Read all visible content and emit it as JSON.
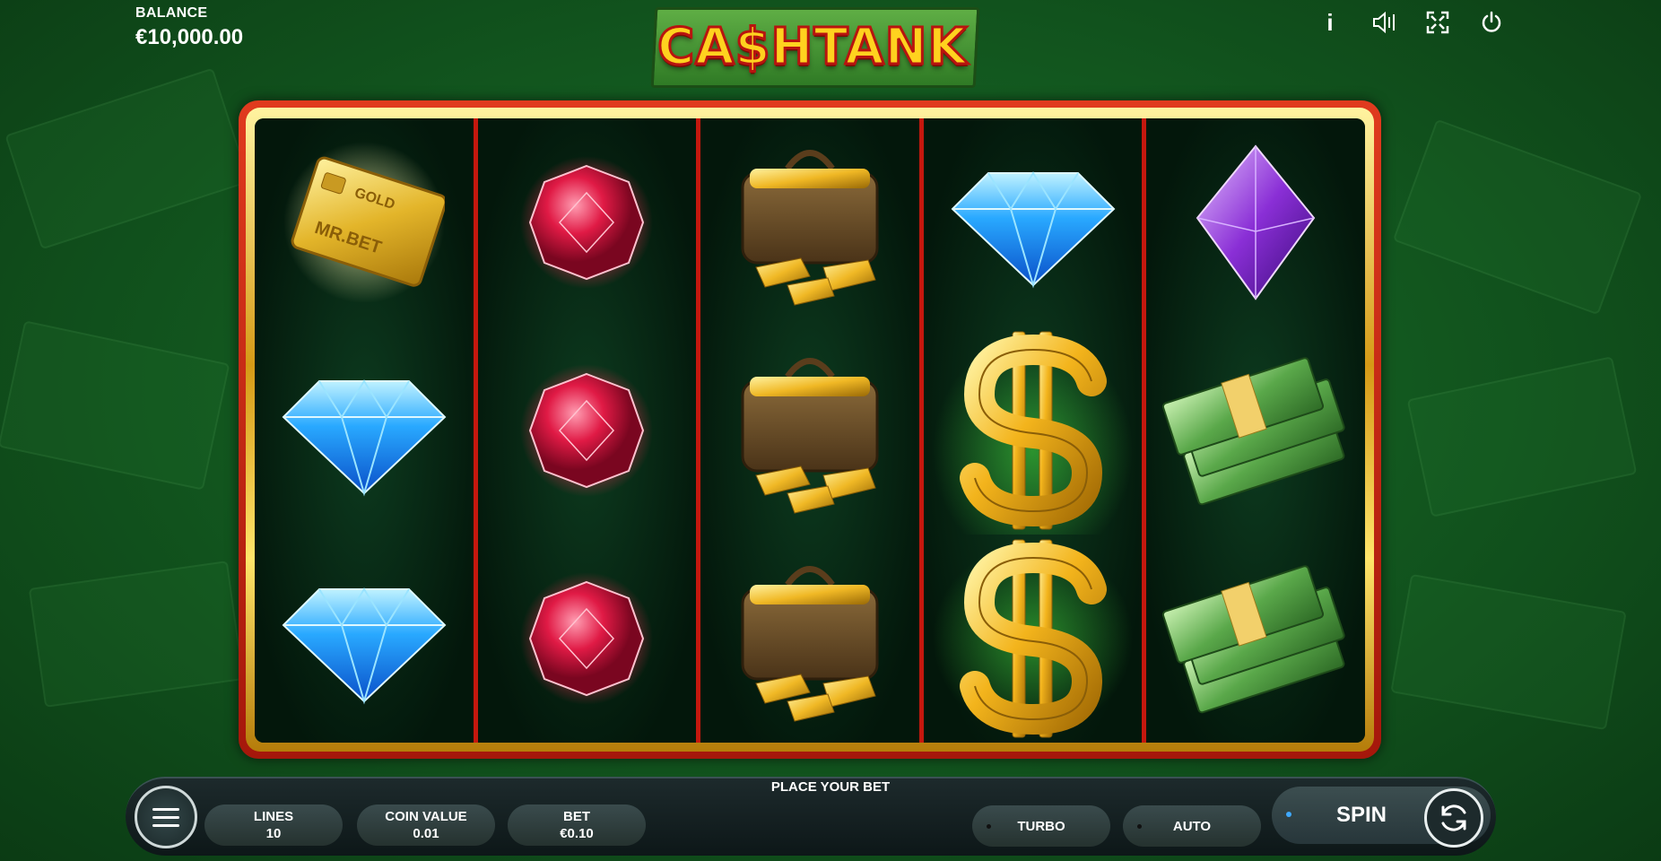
{
  "balance": {
    "label": "BALANCE",
    "value": "€10,000.00"
  },
  "logo": {
    "text": "CA$HTANK"
  },
  "top_icons": [
    {
      "name": "info-icon",
      "glyph": "i"
    },
    {
      "name": "sound-icon",
      "glyph": "◁|"
    },
    {
      "name": "fullscreen-icon",
      "glyph": "⛶"
    },
    {
      "name": "power-icon",
      "glyph": "⏻"
    }
  ],
  "reels": [
    [
      "gold-card",
      "blue-diamond",
      "blue-diamond"
    ],
    [
      "red-ruby",
      "red-ruby",
      "red-ruby"
    ],
    [
      "money-bag",
      "money-bag",
      "money-bag"
    ],
    [
      "blue-diamond",
      "dollar-sign",
      "dollar-sign"
    ],
    [
      "purple-gem",
      "cash-stack",
      "cash-stack"
    ]
  ],
  "gold_card": {
    "line1": "GOLD",
    "line2": "MR.BET"
  },
  "bottom": {
    "place_bet": "PLACE YOUR BET",
    "lines": {
      "label": "LINES",
      "value": "10"
    },
    "coin_value": {
      "label": "COIN VALUE",
      "value": "0.01"
    },
    "bet": {
      "label": "BET",
      "value": "€0.10"
    },
    "turbo": "TURBO",
    "auto": "AUTO",
    "spin": "SPIN"
  },
  "colors": {
    "frame_red": "#c5180e",
    "frame_gold": "#e8b528",
    "background_green": "#1b6b2a",
    "spin_dot": "#3fa9ff"
  }
}
